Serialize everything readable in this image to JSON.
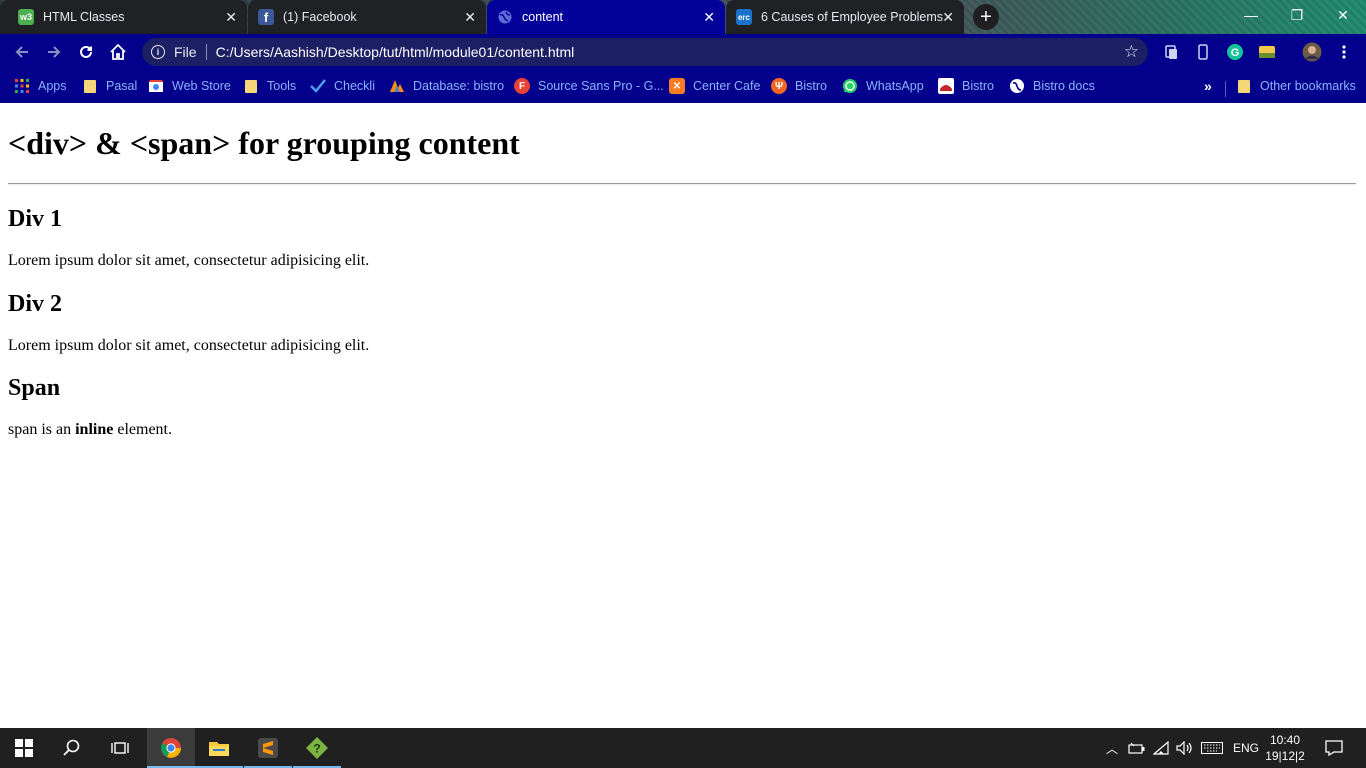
{
  "tabs": [
    {
      "title": "HTML Classes",
      "favicon": "w3schools-icon",
      "active": false
    },
    {
      "title": "(1) Facebook",
      "favicon": "facebook-icon",
      "active": false
    },
    {
      "title": "content",
      "favicon": "globe-icon",
      "active": true
    },
    {
      "title": "6 Causes of Employee Problems",
      "favicon": "erc-icon",
      "active": false
    }
  ],
  "toolbar": {
    "scheme_label": "File",
    "url": "C:/Users/Aashish/Desktop/tut/html/module01/content.html"
  },
  "bookmarks": [
    {
      "label": "Apps",
      "icon": "apps-grid-icon"
    },
    {
      "label": "Pasal",
      "icon": "folder-icon"
    },
    {
      "label": "Web Store",
      "icon": "webstore-icon"
    },
    {
      "label": "Tools",
      "icon": "folder-icon"
    },
    {
      "label": "Checkli",
      "icon": "checkmark-icon"
    },
    {
      "label": "Database: bistro",
      "icon": "phpmyadmin-icon"
    },
    {
      "label": "Source Sans Pro - G...",
      "icon": "google-fonts-icon"
    },
    {
      "label": "Center Cafe",
      "icon": "xampp-icon"
    },
    {
      "label": "Bistro",
      "icon": "bistro-icon"
    },
    {
      "label": "WhatsApp",
      "icon": "whatsapp-icon"
    },
    {
      "label": "Bistro",
      "icon": "bistro-logo-icon"
    },
    {
      "label": "Bistro docs",
      "icon": "globe-icon"
    }
  ],
  "bookmarks_overflow": "»",
  "other_bookmarks": "Other bookmarks",
  "page": {
    "heading": "<div> & <span> for grouping content",
    "sections": [
      {
        "title": "Div 1",
        "text": "Lorem ipsum dolor sit amet, consectetur adipisicing elit."
      },
      {
        "title": "Div 2",
        "text": "Lorem ipsum dolor sit amet, consectetur adipisicing elit."
      }
    ],
    "span_section": {
      "title": "Span",
      "text_before": "span is an ",
      "text_bold": "inline",
      "text_after": " element."
    }
  },
  "taskbar": {
    "language": "ENG",
    "time": "10:40",
    "date": "19|12|2"
  },
  "colors": {
    "tab_active": "#02019a",
    "toolbar": "#03008c",
    "bookmark_text": "#8ab4ff",
    "taskbar": "#202020"
  }
}
